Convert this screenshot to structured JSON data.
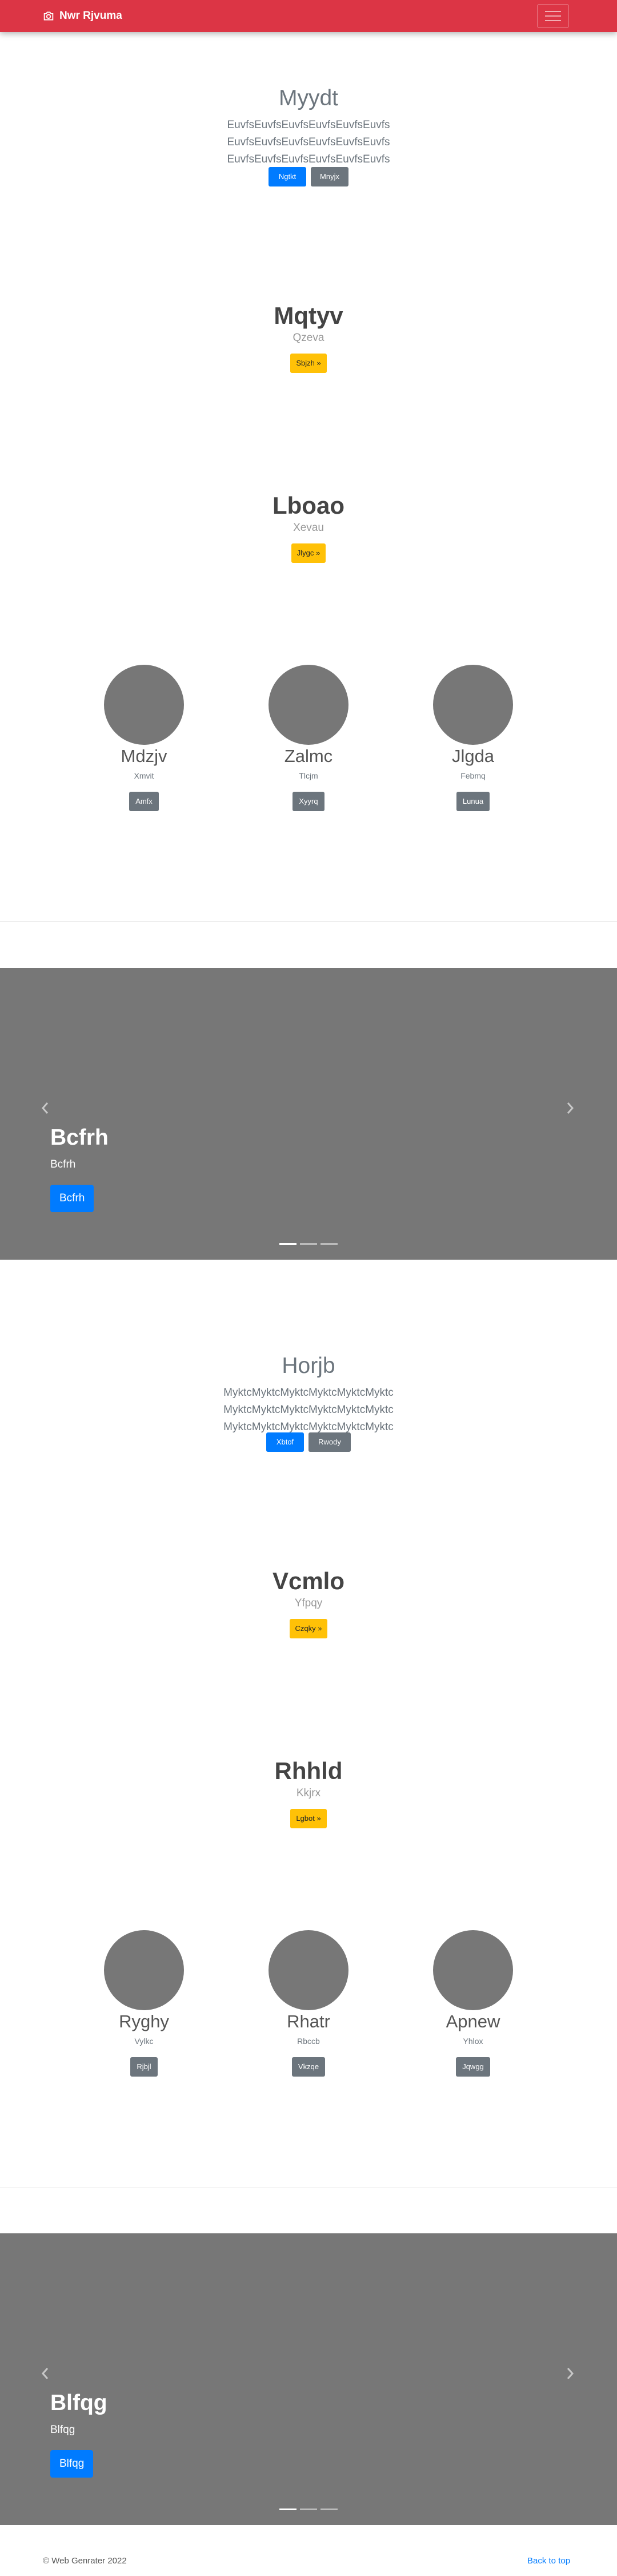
{
  "navbar": {
    "brand": "Nwr Rjvuma",
    "icon": "camera-icon",
    "toggle_icon": "menu-icon"
  },
  "jumbo1": {
    "title": "Myydt",
    "lead": "EuvfsEuvfsEuvfsEuvfsEuvfsEuvfs EuvfsEuvfsEuvfsEuvfsEuvfsEuvfs EuvfsEuvfsEuvfsEuvfsEuvfsEuvfs",
    "primary_button": "Ngtkt",
    "secondary_button": "Mnyjx"
  },
  "feature1": {
    "title": "Mqtyv",
    "subtitle": "Qzeva",
    "button": "Sbjzh »"
  },
  "feature2": {
    "title": "Lboao",
    "subtitle": "Xevau",
    "button": "Jlygc »"
  },
  "team1": [
    {
      "name": "Mdzjv",
      "role": "Xmvit",
      "button": "Amfx"
    },
    {
      "name": "Zalmc",
      "role": "Tlcjm",
      "button": "Xyyrq"
    },
    {
      "name": "Jlgda",
      "role": "Febmq",
      "button": "Lunua"
    }
  ],
  "carousel1": {
    "title": "Bcfrh",
    "subtitle": "Bcfrh",
    "button": "Bcfrh",
    "slides": 3,
    "active": 1
  },
  "jumbo2": {
    "title": "Horjb",
    "lead": "MyktcMyktcMyktcMyktcMyktcMyktc MyktcMyktcMyktcMyktcMyktcMyktc MyktcMyktcMyktcMyktcMyktcMyktc",
    "primary_button": "Xbtof",
    "secondary_button": "Rwody"
  },
  "feature3": {
    "title": "Vcmlo",
    "subtitle": "Yfpqy",
    "button": "Czqky »"
  },
  "feature4": {
    "title": "Rhhld",
    "subtitle": "Kkjrx",
    "button": "Lgbot »"
  },
  "team2": [
    {
      "name": "Ryghy",
      "role": "Vylkc",
      "button": "Rjbjl"
    },
    {
      "name": "Rhatr",
      "role": "Rbccb",
      "button": "Vkzqe"
    },
    {
      "name": "Apnew",
      "role": "Yhlox",
      "button": "Jqwgg"
    }
  ],
  "carousel2": {
    "title": "Blfqg",
    "subtitle": "Blfqg",
    "button": "Blfqg",
    "slides": 3,
    "active": 1
  },
  "footer": {
    "copyright": "© Web Genrater 2022",
    "back_to_top": "Back to top"
  }
}
